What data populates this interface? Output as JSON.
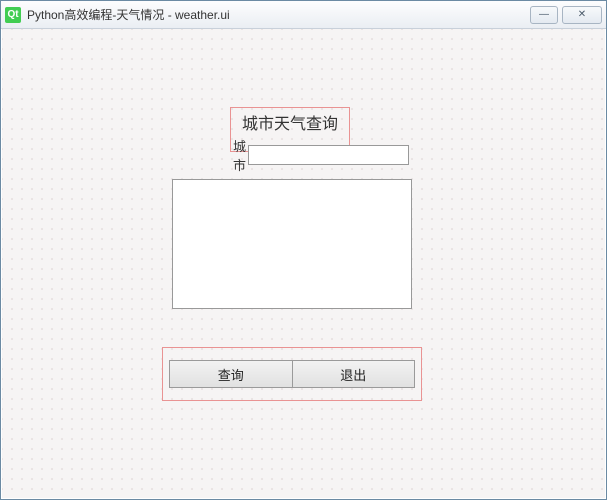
{
  "window": {
    "qt_icon_text": "Qt",
    "title": "Python高效编程-天气情况 - weather.ui"
  },
  "header": {
    "title": "城市天气查询",
    "city_label": "城市",
    "city_value": ""
  },
  "result": {
    "text": ""
  },
  "buttons": {
    "query": "查询",
    "exit": "退出"
  },
  "window_controls": {
    "minimize": "—",
    "close": "✕"
  }
}
